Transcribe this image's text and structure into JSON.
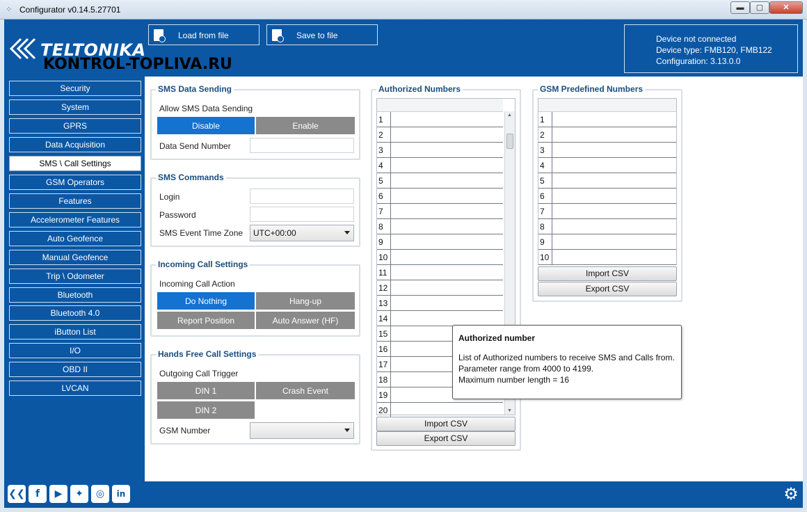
{
  "window": {
    "title": "Configurator v0.14.5.27701",
    "min": "▬",
    "max": "▢",
    "close": "✕"
  },
  "toolbar": {
    "load_label": "Load from file",
    "save_label": "Save to file"
  },
  "brand": {
    "logo": "TELTONIKA",
    "watermark": "KONTROL-TOPLIVA.RU"
  },
  "status": {
    "line1": "Device not connected",
    "line2": "Device type: FMB120, FMB122",
    "line3": "Configuration: 3.13.0.0"
  },
  "sidebar": {
    "items": [
      {
        "label": "Security"
      },
      {
        "label": "System"
      },
      {
        "label": "GPRS"
      },
      {
        "label": "Data Acquisition"
      },
      {
        "label": "SMS \\ Call Settings",
        "active": true
      },
      {
        "label": "GSM Operators"
      },
      {
        "label": "Features"
      },
      {
        "label": "Accelerometer Features"
      },
      {
        "label": "Auto Geofence"
      },
      {
        "label": "Manual Geofence"
      },
      {
        "label": "Trip \\ Odometer"
      },
      {
        "label": "Bluetooth"
      },
      {
        "label": "Bluetooth 4.0"
      },
      {
        "label": "iButton List"
      },
      {
        "label": "I/O"
      },
      {
        "label": "OBD II"
      },
      {
        "label": "LVCAN"
      }
    ]
  },
  "sms_data": {
    "title": "SMS Data Sending",
    "allow_label": "Allow SMS Data Sending",
    "disable": "Disable",
    "enable": "Enable",
    "selected": "Disable",
    "number_label": "Data Send Number",
    "number_value": ""
  },
  "sms_commands": {
    "title": "SMS Commands",
    "login_label": "Login",
    "login_value": "",
    "password_label": "Password",
    "password_value": "",
    "tz_label": "SMS Event Time Zone",
    "tz_value": "UTC+00:00"
  },
  "incoming": {
    "title": "Incoming Call Settings",
    "action_label": "Incoming Call Action",
    "do_nothing": "Do Nothing",
    "hang_up": "Hang-up",
    "report_position": "Report Position",
    "auto_answer": "Auto Answer (HF)",
    "selected": "Do Nothing"
  },
  "handsfree": {
    "title": "Hands Free Call Settings",
    "trigger_label": "Outgoing Call Trigger",
    "din1": "DIN 1",
    "crash": "Crash Event",
    "din2": "DIN 2",
    "gsm_label": "GSM Number",
    "gsm_value": ""
  },
  "authorized": {
    "title": "Authorized Numbers",
    "rows": [
      "1",
      "2",
      "3",
      "4",
      "5",
      "6",
      "7",
      "8",
      "9",
      "10",
      "11",
      "12",
      "13",
      "14",
      "15",
      "16",
      "17",
      "18",
      "19",
      "20"
    ],
    "import": "Import CSV",
    "export": "Export CSV"
  },
  "gsm_predefined": {
    "title": "GSM Predefined Numbers",
    "rows": [
      "1",
      "2",
      "3",
      "4",
      "5",
      "6",
      "7",
      "8",
      "9",
      "10"
    ],
    "import": "Import CSV",
    "export": "Export CSV"
  },
  "tooltip": {
    "title": "Authorized number",
    "line1": "List of Authorized numbers to receive SMS and Calls from.",
    "line2": "Parameter range from 4000 to 4199.",
    "line3": "Maximum number length = 16"
  },
  "footer": {
    "social": [
      {
        "name": "teltonika-icon",
        "glyph": "❮❮"
      },
      {
        "name": "facebook-icon",
        "glyph": "f"
      },
      {
        "name": "youtube-icon",
        "glyph": "▶"
      },
      {
        "name": "twitter-icon",
        "glyph": "✦"
      },
      {
        "name": "instagram-icon",
        "glyph": "◎"
      },
      {
        "name": "linkedin-icon",
        "glyph": "in"
      }
    ],
    "gear": "⚙"
  },
  "colors": {
    "brand_blue": "#0b57a4",
    "selected_blue": "#1472d1",
    "segment_gray": "#8a8a8a"
  }
}
